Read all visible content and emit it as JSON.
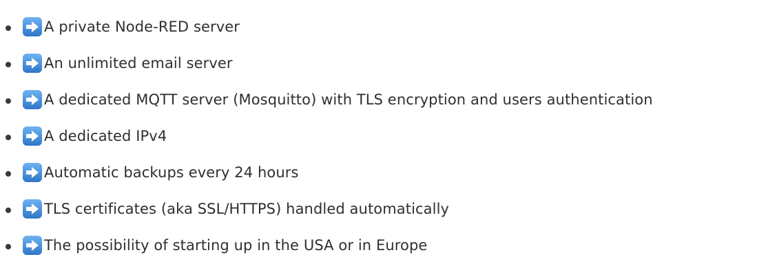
{
  "features": {
    "icon": "right-arrow-emoji-icon",
    "accent_color": "#3E8DDD",
    "items": [
      {
        "label": "A private Node-RED server"
      },
      {
        "label": "An unlimited email server"
      },
      {
        "label": "A dedicated MQTT server (Mosquitto) with TLS encryption and users authentication"
      },
      {
        "label": "A dedicated IPv4"
      },
      {
        "label": "Automatic backups every 24 hours"
      },
      {
        "label": "TLS certificates (aka SSL/HTTPS) handled automatically"
      },
      {
        "label": "The possibility of starting up in the USA or in Europe"
      }
    ]
  }
}
